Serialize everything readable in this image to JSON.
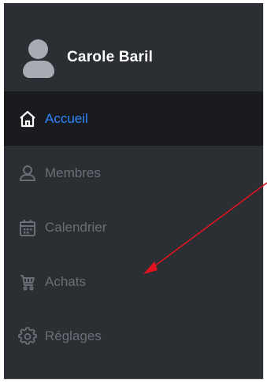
{
  "profile": {
    "name": "Carole Baril",
    "avatar_icon": "user-avatar-icon"
  },
  "nav": {
    "items": [
      {
        "label": "Accueil",
        "icon": "home-icon",
        "active": true
      },
      {
        "label": "Membres",
        "icon": "user-icon",
        "active": false
      },
      {
        "label": "Calendrier",
        "icon": "calendar-icon",
        "active": false
      },
      {
        "label": "Achats",
        "icon": "cart-icon",
        "active": false
      },
      {
        "label": "Réglages",
        "icon": "gear-icon",
        "active": false
      }
    ]
  },
  "colors": {
    "sidebar_bg": "#2b2e33",
    "active_bg": "#1a1b1e",
    "active_text": "#2f86ff",
    "inactive_text": "#6b6f75",
    "annotation_arrow": "#e0141e"
  }
}
